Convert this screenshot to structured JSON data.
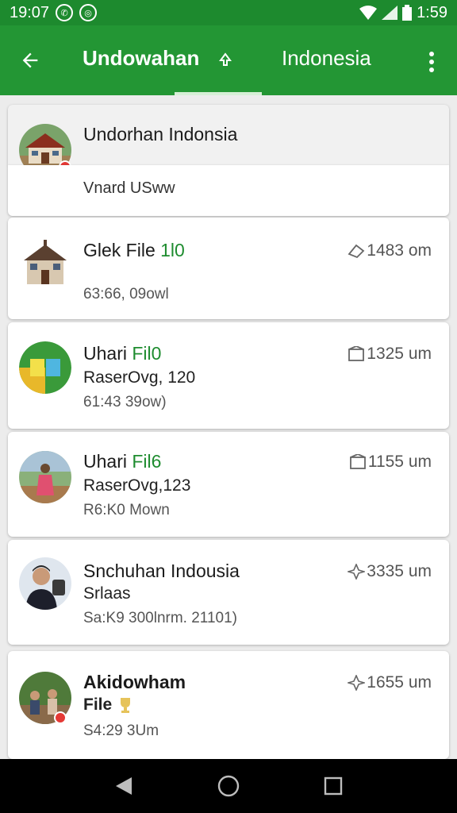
{
  "status_bar": {
    "time": "19:07",
    "right_time": "1:59"
  },
  "app_bar": {
    "title": "Undowahan",
    "second_tab": "Indonesia"
  },
  "group": {
    "title": "Undorhan Indonsia",
    "subtitle": "Vnard USww"
  },
  "items": [
    {
      "name": "Glek File ",
      "accent": "1l0",
      "sub": "",
      "meta": "63:66, 09owl",
      "distance": "1483 om"
    },
    {
      "name": "Uhari ",
      "accent": "Fil0",
      "sub": "RaserOvg, 120",
      "meta": "61:43 39ow)",
      "distance": "1325 um"
    },
    {
      "name": "Uhari ",
      "accent": "Fil6",
      "sub": "RaserOvg,123",
      "meta": "R6:K0 Mown",
      "distance": "1155 um"
    },
    {
      "name": "Snchuhan Indousia",
      "accent": "",
      "sub": "Srlaas",
      "meta": "Sa:K9 300lnrm. 21101)",
      "distance": "3335 um"
    },
    {
      "name": "Akidowham",
      "accent": "",
      "sub": "File",
      "meta": "S4:29 3Um",
      "distance": "1655 um"
    }
  ],
  "colors": {
    "primary": "#239634",
    "status": "#1d8a2e",
    "accent_text": "#1e8c2f",
    "badge": "#e53935"
  }
}
